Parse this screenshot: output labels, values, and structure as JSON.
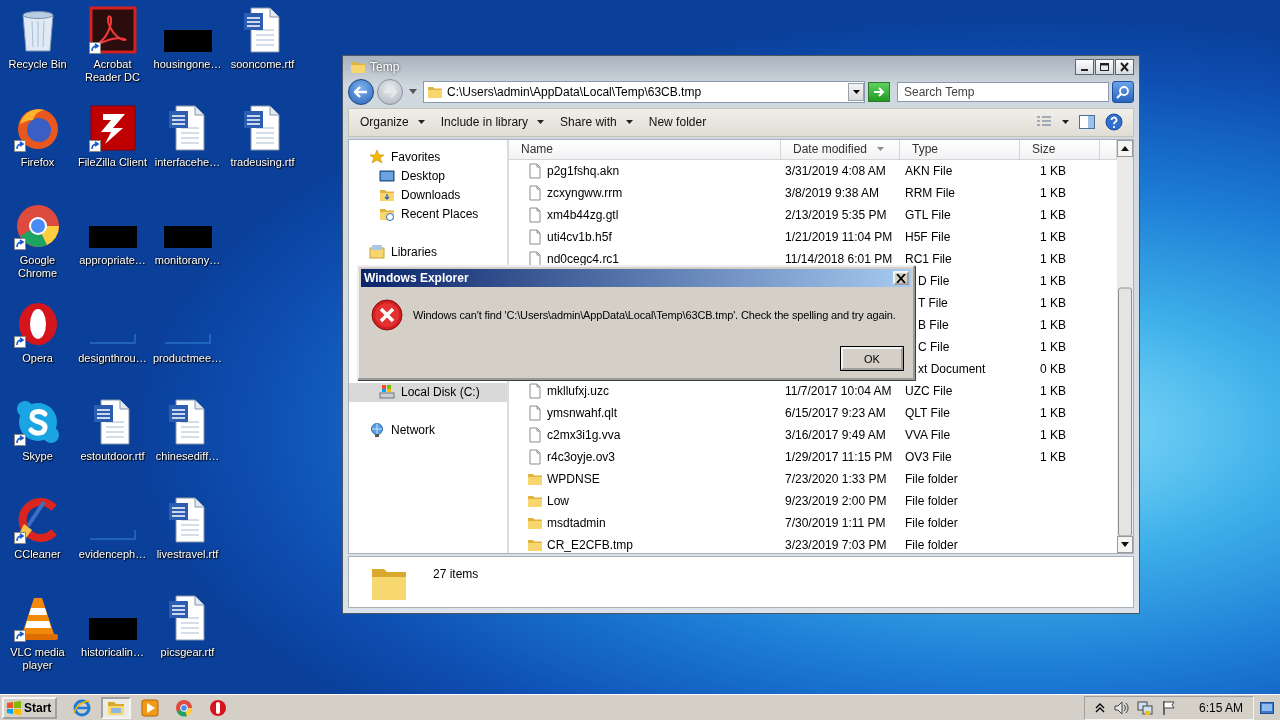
{
  "desktop": {
    "icons": [
      {
        "label": "Recycle Bin",
        "kind": "recycle",
        "shortcut": false
      },
      {
        "label": "Firefox",
        "kind": "firefox",
        "shortcut": true
      },
      {
        "label": "Google Chrome",
        "kind": "chrome",
        "shortcut": true
      },
      {
        "label": "Opera",
        "kind": "opera",
        "shortcut": true
      },
      {
        "label": "Skype",
        "kind": "skype",
        "shortcut": true
      },
      {
        "label": "CCleaner",
        "kind": "ccleaner",
        "shortcut": true
      },
      {
        "label": "VLC media player",
        "kind": "vlc",
        "shortcut": true
      },
      {
        "label": "Acrobat Reader DC",
        "kind": "acrobat",
        "shortcut": true
      },
      {
        "label": "FileZilla Client",
        "kind": "filezilla",
        "shortcut": true
      },
      {
        "label": "appropriate…",
        "kind": "redacted",
        "shortcut": false
      },
      {
        "label": "designthrou…",
        "kind": "blank",
        "shortcut": false
      },
      {
        "label": "estoutdoor.rtf",
        "kind": "word",
        "shortcut": false
      },
      {
        "label": "evidenceph…",
        "kind": "blank",
        "shortcut": false
      },
      {
        "label": "historicalin…",
        "kind": "redacted",
        "shortcut": false
      },
      {
        "label": "housingone…",
        "kind": "redacted",
        "shortcut": false
      },
      {
        "label": "interfacehe…",
        "kind": "word",
        "shortcut": false
      },
      {
        "label": "monitorany…",
        "kind": "redacted",
        "shortcut": false
      },
      {
        "label": "productmee…",
        "kind": "blank",
        "shortcut": false
      },
      {
        "label": "chinesediff…",
        "kind": "word",
        "shortcut": false
      },
      {
        "label": "livestravel.rtf",
        "kind": "word",
        "shortcut": false
      },
      {
        "label": "picsgear.rtf",
        "kind": "word",
        "shortcut": false
      },
      {
        "label": "sooncome.rtf",
        "kind": "word",
        "shortcut": false
      },
      {
        "label": "tradeusing.rtf",
        "kind": "word",
        "shortcut": false
      }
    ]
  },
  "explorer": {
    "title": "Temp",
    "address": "C:\\Users\\admin\\AppData\\Local\\Temp\\63CB.tmp",
    "search": {
      "placeholder": "Search Temp"
    },
    "toolbar": [
      {
        "label": "Organize",
        "menu": true
      },
      {
        "label": "Include in library",
        "menu": true
      },
      {
        "label": "Share with",
        "menu": true
      },
      {
        "label": "New folder",
        "menu": false
      }
    ],
    "nav": [
      {
        "label": "Favorites",
        "kind": "favorites",
        "selected": false,
        "children": [
          {
            "label": "Desktop",
            "kind": "desktop",
            "selected": false
          },
          {
            "label": "Downloads",
            "kind": "downloads",
            "selected": false
          },
          {
            "label": "Recent Places",
            "kind": "recent",
            "selected": false
          }
        ]
      },
      {
        "label": "Libraries",
        "kind": "libraries",
        "selected": false
      },
      {
        "label": "Local Disk (C:)",
        "kind": "drive",
        "selected": true
      },
      {
        "label": "Network",
        "kind": "network",
        "selected": false
      }
    ],
    "columns": [
      {
        "label": "Name",
        "sorted": false
      },
      {
        "label": "Date modified",
        "sorted": true
      },
      {
        "label": "Type",
        "sorted": false
      },
      {
        "label": "Size",
        "sorted": false
      }
    ],
    "rows": [
      {
        "kind": "file",
        "name": "p2g1fshq.akn",
        "date": "3/31/2019 4:08 AM",
        "type": "AKN File",
        "size": "1 KB"
      },
      {
        "kind": "file",
        "name": "zcxyngww.rrm",
        "date": "3/8/2019 9:38 AM",
        "type": "RRM File",
        "size": "1 KB"
      },
      {
        "kind": "file",
        "name": "xm4b44zg.gtl",
        "date": "2/13/2019 5:35 PM",
        "type": "GTL File",
        "size": "1 KB"
      },
      {
        "kind": "file",
        "name": "uti4cv1b.h5f",
        "date": "1/21/2019 11:04 PM",
        "type": "H5F File",
        "size": "1 KB"
      },
      {
        "kind": "file",
        "name": "nd0cegc4.rc1",
        "date": "11/14/2018 6:01 PM",
        "type": "RC1 File",
        "size": "1 KB"
      },
      {
        "type": "D File",
        "size": "1 KB"
      },
      {
        "type": "T File",
        "size": "1 KB"
      },
      {
        "type": "B File",
        "size": "1 KB"
      },
      {
        "type": "C File",
        "size": "1 KB"
      },
      {
        "type": "xt Document",
        "size": "0 KB"
      },
      {
        "kind": "file",
        "name": "mkllufxj.uzc",
        "date": "11/7/2017 10:04 AM",
        "type": "UZC File",
        "size": "1 KB"
      },
      {
        "kind": "file",
        "name": "ymsnwahf.qlt",
        "date": "6/15/2017 9:23 AM",
        "type": "QLT File",
        "size": "1 KB"
      },
      {
        "kind": "file",
        "name": "c2mx3i1g.vva",
        "date": "3/16/2017 9:49 AM",
        "type": "VVA File",
        "size": "1 KB"
      },
      {
        "kind": "file",
        "name": "r4c3oyje.ov3",
        "date": "1/29/2017 11:15 PM",
        "type": "OV3 File",
        "size": "1 KB"
      },
      {
        "kind": "folder",
        "name": "WPDNSE",
        "date": "7/23/2020 1:33 PM",
        "type": "File folder"
      },
      {
        "kind": "folder",
        "name": "Low",
        "date": "9/23/2019 2:00 PM",
        "type": "File folder"
      },
      {
        "kind": "folder",
        "name": "msdtadmin",
        "date": "7/30/2019 1:11 PM",
        "type": "File folder"
      },
      {
        "kind": "folder",
        "name": "CR_E2CFB.tmp",
        "date": "3/23/2019 7:03 PM",
        "type": "File folder"
      }
    ],
    "details": {
      "count": "27 items"
    }
  },
  "dialog": {
    "title": "Windows Explorer",
    "message": "Windows can't find 'C:\\Users\\admin\\AppData\\Local\\Temp\\63CB.tmp'.  Check the spelling and try again.",
    "buttons": [
      "OK"
    ]
  },
  "taskbar": {
    "start": "Start",
    "apps": [
      {
        "kind": "ie",
        "active": false
      },
      {
        "kind": "explorer",
        "active": true
      },
      {
        "kind": "media",
        "active": false
      },
      {
        "kind": "chrome",
        "active": false
      },
      {
        "kind": "opera",
        "active": false
      }
    ],
    "clock": "6:15 AM"
  }
}
